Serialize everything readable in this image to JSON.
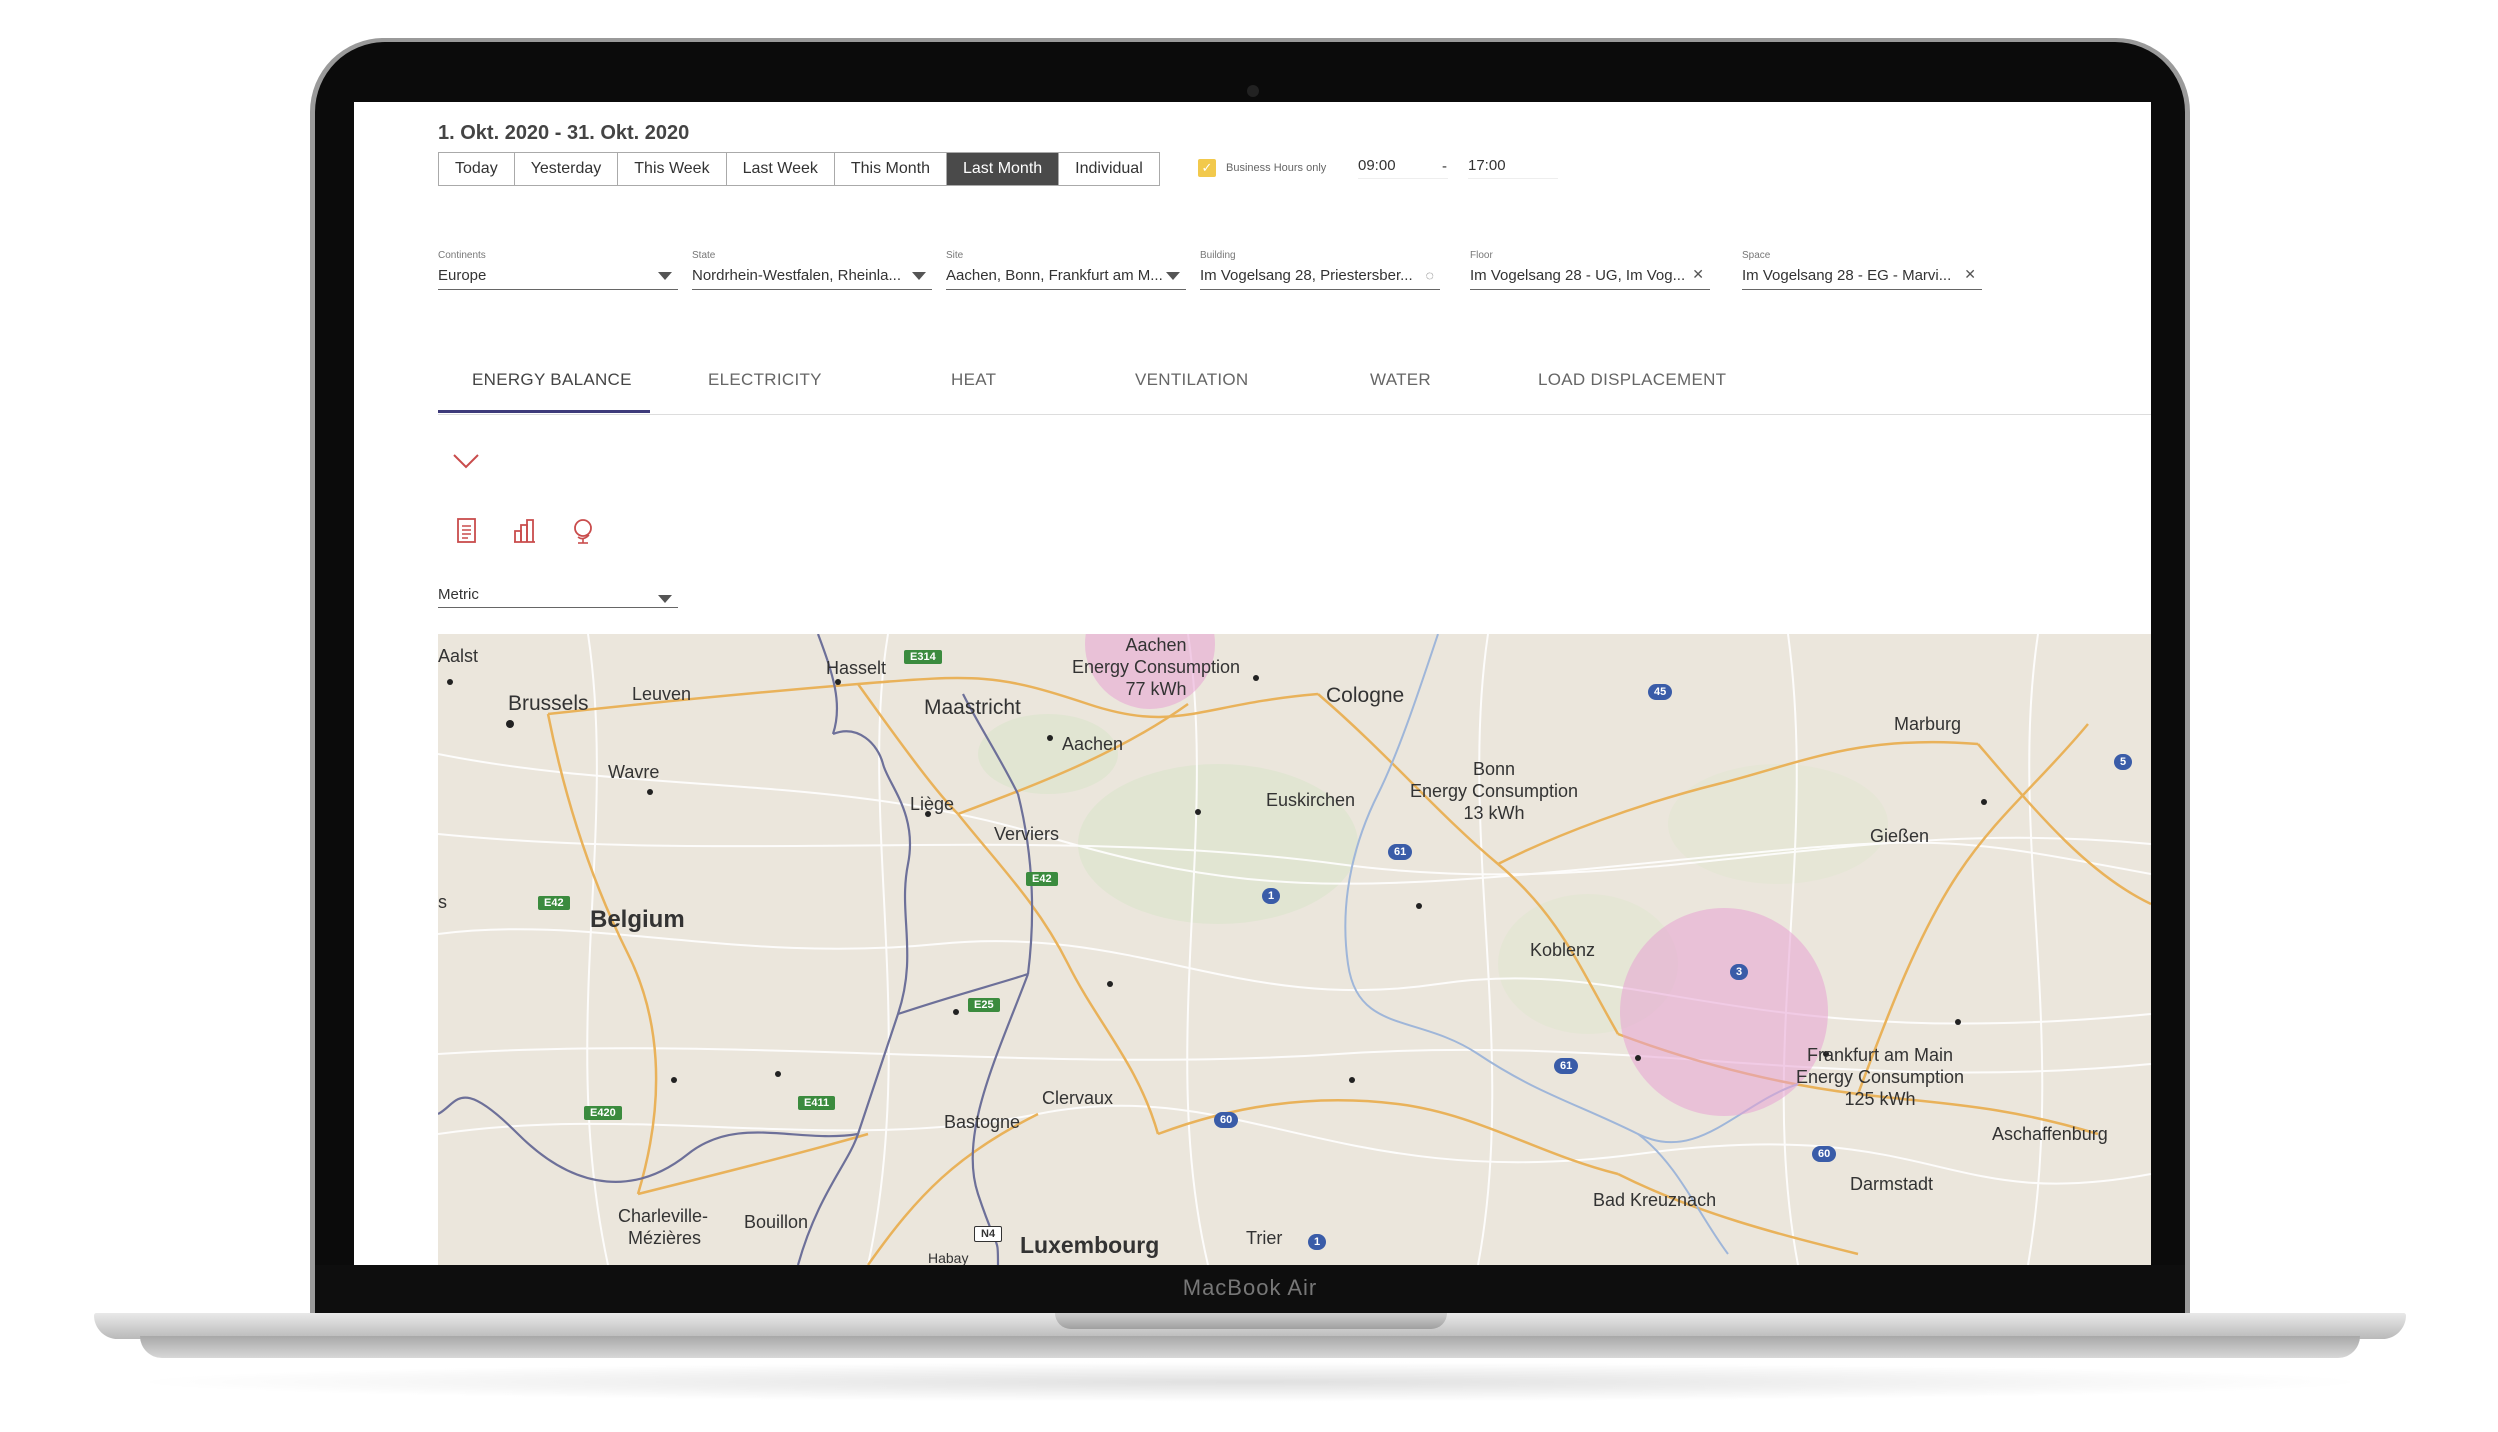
{
  "device": {
    "chin_label": "MacBook Air"
  },
  "date_range": "1. Okt. 2020  - 31. Okt. 2020",
  "quick_ranges": [
    {
      "label": "Today",
      "active": false
    },
    {
      "label": "Yesterday",
      "active": false
    },
    {
      "label": "This Week",
      "active": false
    },
    {
      "label": "Last Week",
      "active": false
    },
    {
      "label": "This Month",
      "active": false
    },
    {
      "label": "Last Month",
      "active": true
    },
    {
      "label": "Individual",
      "active": false
    }
  ],
  "business_hours": {
    "label": "Business Hours only",
    "checked": true,
    "from": "09:00",
    "separator": "-",
    "to": "17:00"
  },
  "filters": {
    "continents": {
      "label": "Continents",
      "value": "Europe"
    },
    "state": {
      "label": "State",
      "value": "Nordrhein-Westfalen, Rheinla..."
    },
    "site": {
      "label": "Site",
      "value": "Aachen, Bonn, Frankfurt am M..."
    },
    "building": {
      "label": "Building",
      "value": "Im Vogelsang 28, Priestersber..."
    },
    "floor": {
      "label": "Floor",
      "value": "Im Vogelsang 28 - UG, Im Vog..."
    },
    "space": {
      "label": "Space",
      "value": "Im Vogelsang 28 - EG - Marvi..."
    }
  },
  "tabs": [
    "ENERGY BALANCE",
    "ELECTRICITY",
    "HEAT",
    "VENTILATION",
    "WATER",
    "LOAD DISPLACEMENT"
  ],
  "active_tab": "ENERGY BALANCE",
  "metric_select": {
    "value": "Metric"
  },
  "colors": {
    "accent": "#3d3a7a",
    "icon_red": "#c94c4c",
    "bubble": "#e8a3d4",
    "checkbox": "#f2c94c"
  },
  "map": {
    "bubbles": [
      {
        "city": "Aachen",
        "label": "Energy Consumption",
        "value": "77 kWh"
      },
      {
        "city": "Bonn",
        "label": "Energy Consumption",
        "value": "13 kWh"
      },
      {
        "city": "Frankfurt am Main",
        "label": "Energy Consumption",
        "value": "125 kWh"
      }
    ],
    "places": {
      "aalst": "Aalst",
      "brussels": "Brussels",
      "leuven": "Leuven",
      "hasselt": "Hasselt",
      "maastricht": "Maastricht",
      "aachen": "Aachen",
      "cologne": "Cologne",
      "marburg": "Marburg",
      "wavre": "Wavre",
      "liege": "Liège",
      "verviers": "Verviers",
      "euskirchen": "Euskirchen",
      "giessen": "Gießen",
      "belgium": "Belgium",
      "koblenz": "Koblenz",
      "clervaux": "Clervaux",
      "bastogne": "Bastogne",
      "charleville": "Charleville-",
      "mezieres": "Mézières",
      "bouillon": "Bouillon",
      "luxembourg": "Luxembourg",
      "trier": "Trier",
      "bad_kreuznach": "Bad Kreuznach",
      "darmstadt": "Darmstadt",
      "aschaffenburg": "Aschaffenburg",
      "habay": "Habay",
      "s_edge": "s"
    },
    "road_shields": {
      "e314": "E314",
      "e42a": "E42",
      "e42b": "E42",
      "e25": "E25",
      "e411": "E411",
      "e420": "E420",
      "n4": "N4",
      "a45": "45",
      "a5": "5",
      "a61a": "61",
      "a1a": "1",
      "a3": "3",
      "a61b": "61",
      "a60a": "60",
      "a60b": "60",
      "a1b": "1"
    }
  }
}
